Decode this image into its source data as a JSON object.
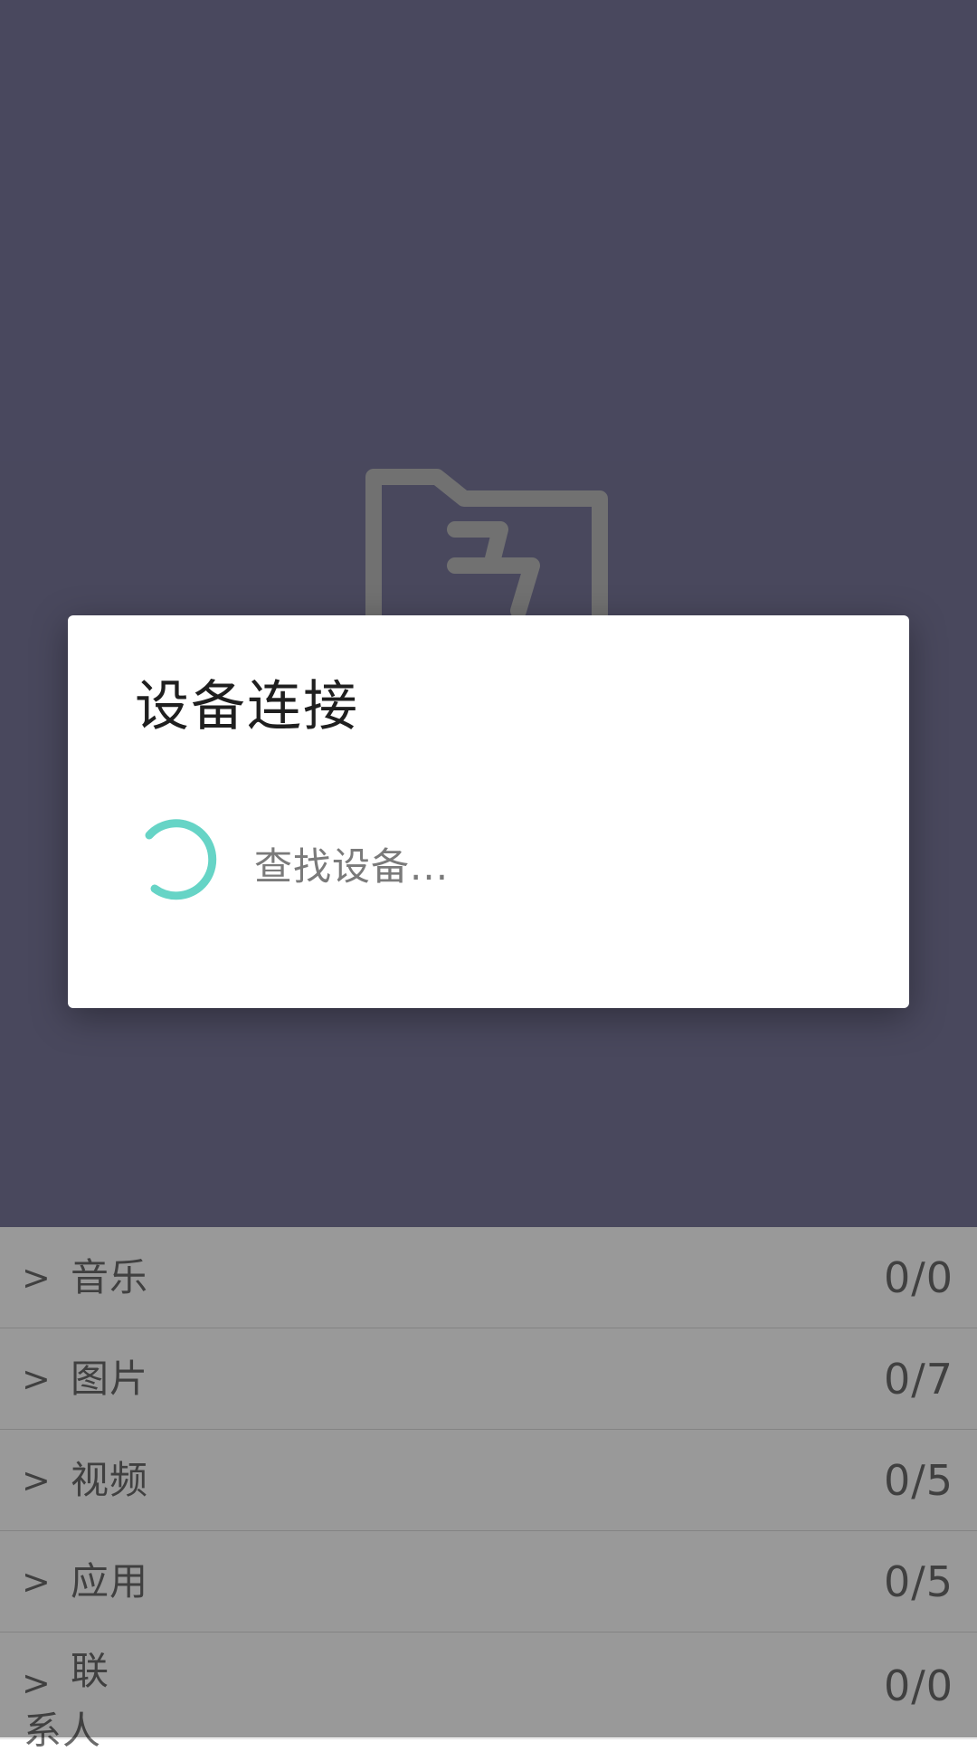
{
  "colors": {
    "hero_bg": "#7a789c",
    "scrim": "rgba(0,0,0,0.40)",
    "accent_spinner": "#66d4c6",
    "dialog_bg": "#ffffff"
  },
  "hero": {
    "icon": "folder-transfer-icon"
  },
  "dialog": {
    "title": "设备连接",
    "message": "查找设备...",
    "spinner_icon": "loading-spinner-icon"
  },
  "categories": [
    {
      "chevron": ">",
      "label": "音乐",
      "count": "0/0"
    },
    {
      "chevron": ">",
      "label": "图片",
      "count": "0/7"
    },
    {
      "chevron": ">",
      "label": "视频",
      "count": "0/5"
    },
    {
      "chevron": ">",
      "label": "应用",
      "count": "0/5"
    },
    {
      "chevron": ">",
      "label": "联系人",
      "count": "0/0"
    }
  ]
}
